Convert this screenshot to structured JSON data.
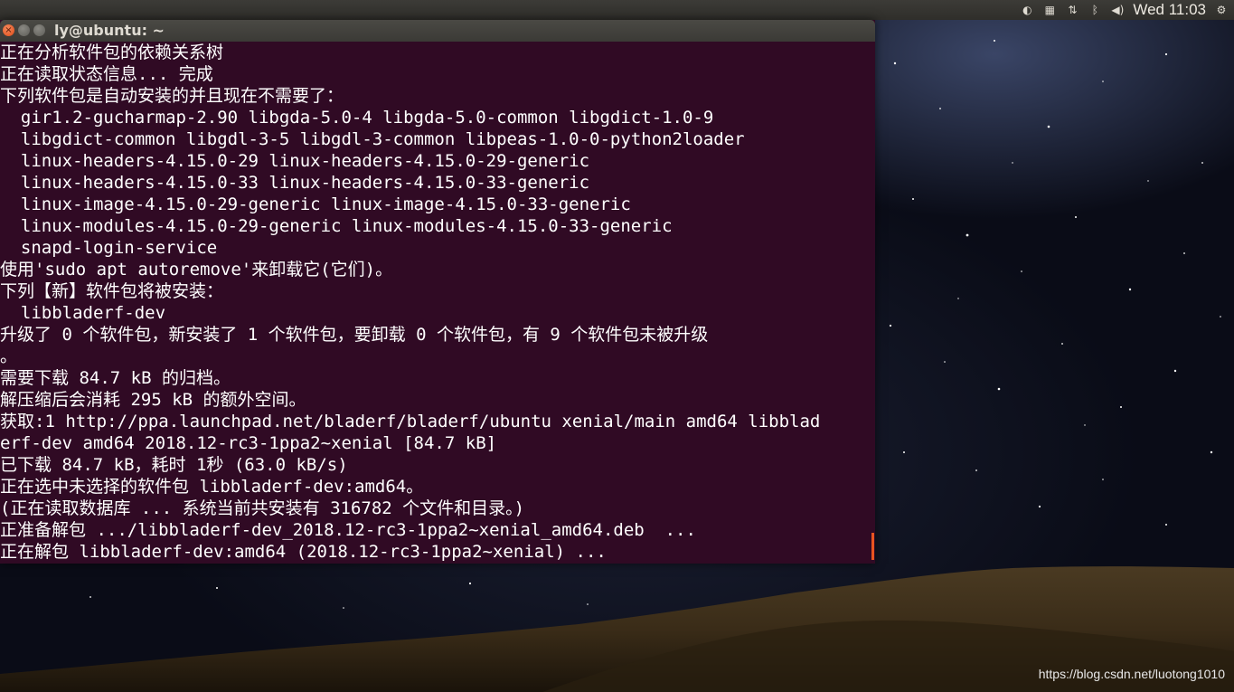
{
  "panel": {
    "clock": "Wed 11:03"
  },
  "window": {
    "title": "ly@ubuntu: ~"
  },
  "terminal": {
    "lines": [
      "正在分析软件包的依赖关系树",
      "正在读取状态信息... 完成",
      "下列软件包是自动安装的并且现在不需要了：",
      "  gir1.2-gucharmap-2.90 libgda-5.0-4 libgda-5.0-common libgdict-1.0-9",
      "  libgdict-common libgdl-3-5 libgdl-3-common libpeas-1.0-0-python2loader",
      "  linux-headers-4.15.0-29 linux-headers-4.15.0-29-generic",
      "  linux-headers-4.15.0-33 linux-headers-4.15.0-33-generic",
      "  linux-image-4.15.0-29-generic linux-image-4.15.0-33-generic",
      "  linux-modules-4.15.0-29-generic linux-modules-4.15.0-33-generic",
      "  snapd-login-service",
      "使用'sudo apt autoremove'来卸载它(它们)。",
      "下列【新】软件包将被安装：",
      "  libbladerf-dev",
      "升级了 0 个软件包，新安装了 1 个软件包，要卸载 0 个软件包，有 9 个软件包未被升级",
      "。",
      "需要下载 84.7 kB 的归档。",
      "解压缩后会消耗 295 kB 的额外空间。",
      "获取:1 http://ppa.launchpad.net/bladerf/bladerf/ubuntu xenial/main amd64 libblad",
      "erf-dev amd64 2018.12-rc3-1ppa2~xenial [84.7 kB]",
      "已下载 84.7 kB，耗时 1秒 (63.0 kB/s)",
      "正在选中未选择的软件包 libbladerf-dev:amd64。",
      "(正在读取数据库 ... 系统当前共安装有 316782 个文件和目录。)",
      "正准备解包 .../libbladerf-dev_2018.12-rc3-1ppa2~xenial_amd64.deb  ...",
      "正在解包 libbladerf-dev:amd64 (2018.12-rc3-1ppa2~xenial) ..."
    ]
  },
  "watermark": "https://blog.csdn.net/luotong1010",
  "colors": {
    "terminal_bg": "#300a24",
    "accent": "#e95420",
    "panel_bg": "#3c3b37"
  }
}
